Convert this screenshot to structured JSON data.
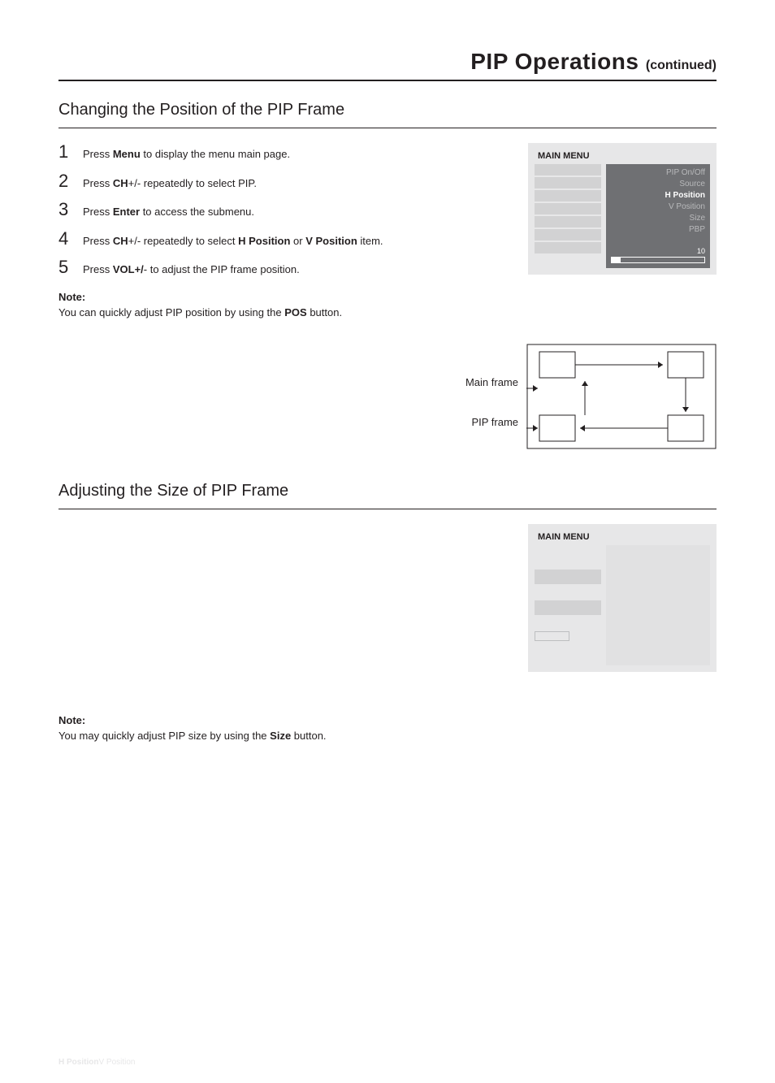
{
  "header": {
    "title_main": "PIP Operations",
    "title_sub": " (continued)"
  },
  "section1": {
    "title": "Changing the Position of the PIP Frame",
    "steps": [
      {
        "n": "1",
        "pre": "Press  ",
        "bold1": "Menu",
        "mid": " to display the menu main page.",
        "bold2": "",
        "post": ""
      },
      {
        "n": "2",
        "pre": "Press ",
        "bold1": "CH",
        "mid": "+/- repeatedly to select PIP.",
        "bold2": "",
        "post": ""
      },
      {
        "n": "3",
        "pre": "Press ",
        "bold1": "Enter",
        "mid": " to access the submenu.",
        "bold2": "",
        "post": ""
      },
      {
        "n": "4",
        "pre": "Press ",
        "bold1": "CH",
        "mid": "+/- repeatedly to select ",
        "bold2": "H Position",
        "post": " or ",
        "bold3": "V Position",
        "post2": " item."
      },
      {
        "n": "5",
        "pre": "Press  ",
        "bold1": "VOL+/",
        "mid": "- to adjust the PIP frame position.",
        "bold2": "",
        "post": ""
      }
    ],
    "note_label": "Note:",
    "note_text_pre": "You can quickly adjust PIP position by using the ",
    "note_text_bold": "POS",
    "note_text_post": " button.",
    "osd": {
      "title": "MAIN MENU",
      "items": [
        "PIP On/Off",
        "Source",
        "H Position",
        "V Position",
        "Size",
        "PBP"
      ],
      "selected_index": 2,
      "slider_value": "10",
      "slider_fill_pct": 10
    },
    "diagram": {
      "main_label": "Main frame",
      "pip_label": "PIP frame"
    }
  },
  "section2": {
    "title": "Adjusting the Size of PIP Frame",
    "osd": {
      "title": "MAIN MENU"
    },
    "note_label": "Note:",
    "note_text_pre": "You may quickly adjust PIP size by using the ",
    "note_text_bold": "Size",
    "note_text_post": " button."
  },
  "footer": {
    "h": "H Position",
    "v": "V Position"
  }
}
